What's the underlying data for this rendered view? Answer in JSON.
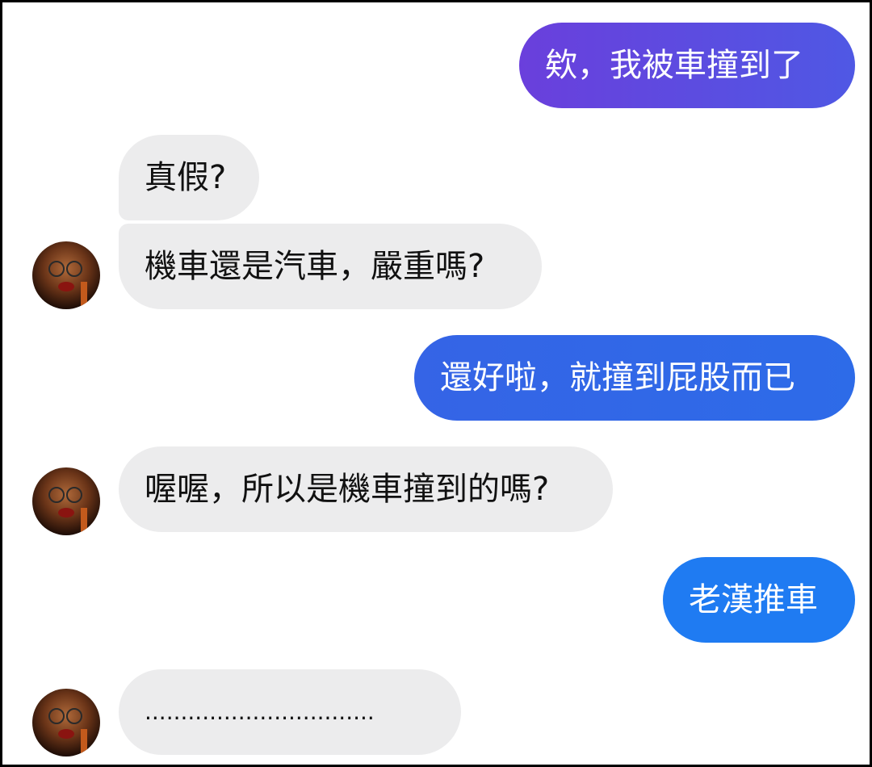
{
  "conversation": {
    "messages": [
      {
        "id": "m1",
        "from": "me",
        "text": "欸，我被車撞到了",
        "color": "#5a4de0"
      },
      {
        "id": "m2",
        "from": "friend",
        "text": "真假?"
      },
      {
        "id": "m3",
        "from": "friend",
        "text": "機車還是汽車，嚴重嗎?"
      },
      {
        "id": "m4",
        "from": "me",
        "text": "還好啦，就撞到屁股而已",
        "color": "#2f69e6"
      },
      {
        "id": "m5",
        "from": "friend",
        "text": "喔喔，所以是機車撞到的嗎?"
      },
      {
        "id": "m6",
        "from": "me",
        "text": "老漢推車",
        "color": "#1d7cf2"
      },
      {
        "id": "m7",
        "from": "friend",
        "text": "................................"
      }
    ]
  },
  "colors": {
    "sent_gradient_top": "#5a4de0",
    "sent_gradient_mid": "#2f69e6",
    "sent_gradient_bottom": "#1d7cf2",
    "received_bubble": "#ececed",
    "background": "#ffffff",
    "frame": "#000000"
  },
  "icons": {
    "avatar": "profile-photo-icon"
  }
}
